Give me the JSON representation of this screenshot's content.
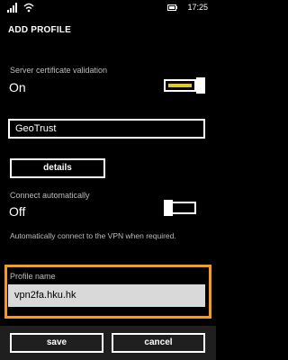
{
  "status_bar": {
    "time": "17:25",
    "signal_icon": "signal-bars-icon",
    "wifi_icon": "wifi-icon",
    "battery_icon": "battery-icon"
  },
  "header": {
    "title": "ADD PROFILE"
  },
  "server_cert": {
    "label": "Server certificate validation",
    "state_label": "On",
    "on": true,
    "accent_color": "#e8cc00"
  },
  "certificate_issuer": {
    "value": "GeoTrust"
  },
  "details": {
    "label": "details"
  },
  "connect_auto": {
    "label": "Connect automatically",
    "state_label": "Off",
    "on": false,
    "helper": "Automatically connect to the VPN when required."
  },
  "profile_name": {
    "label": "Profile name",
    "value": "vpn2fa.hku.hk",
    "highlight_color": "#f39c1f"
  },
  "app_bar": {
    "save_label": "save",
    "cancel_label": "cancel"
  }
}
